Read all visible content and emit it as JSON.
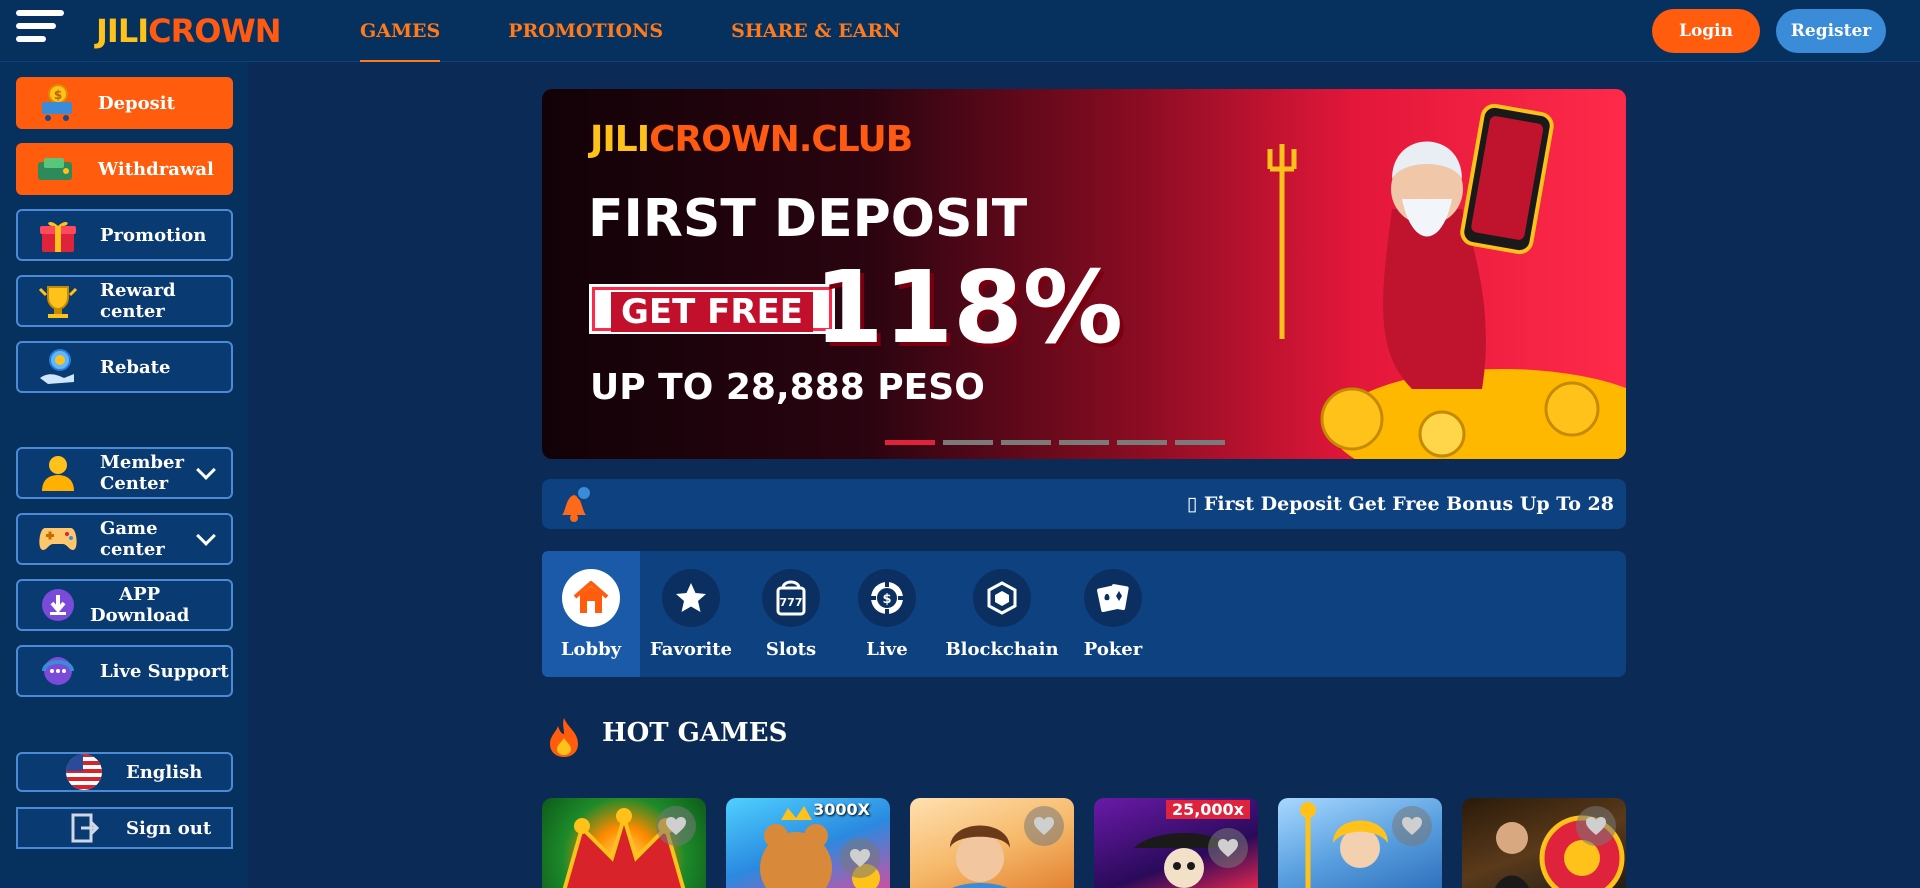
{
  "header": {
    "logo_part1": "JILI",
    "logo_part2": "CROWN",
    "nav": [
      "GAMES",
      "PROMOTIONS",
      "SHARE & EARN"
    ],
    "login": "Login",
    "register": "Register"
  },
  "sidebar": {
    "deposit": "Deposit",
    "withdrawal": "Withdrawal",
    "promotion": "Promotion",
    "reward_line1": "Reward",
    "reward_line2": "center",
    "rebate": "Rebate",
    "member_line1": "Member",
    "member_line2": "Center",
    "game_line1": "Game",
    "game_line2": "center",
    "app_line1": "APP",
    "app_line2": "Download",
    "live_support": "Live Support",
    "language": "English",
    "sign_out": "Sign out"
  },
  "banner": {
    "brand_part1": "JILI",
    "brand_part2": "CROWN.CLUB",
    "headline": "FIRST DEPOSIT",
    "get_free": "GET FREE",
    "percent": "118%",
    "up_to": "UP TO 28,888 PESO",
    "slide_count": 6,
    "active_slide": 0
  },
  "ticker": {
    "message": "▯ First Deposit Get Free Bonus Up To 28"
  },
  "categories": [
    "Lobby",
    "Favorite",
    "Slots",
    "Live",
    "Blockchain",
    "Poker"
  ],
  "hot_games": {
    "title": "HOT GAMES",
    "multipliers": [
      "3000X",
      "25,000x"
    ]
  },
  "colors": {
    "accent": "#ff5c0e",
    "nav_text": "#ff7a1a",
    "header_bg": "#06305e",
    "body_bg": "#0b2a55",
    "register": "#3b8cd8"
  }
}
